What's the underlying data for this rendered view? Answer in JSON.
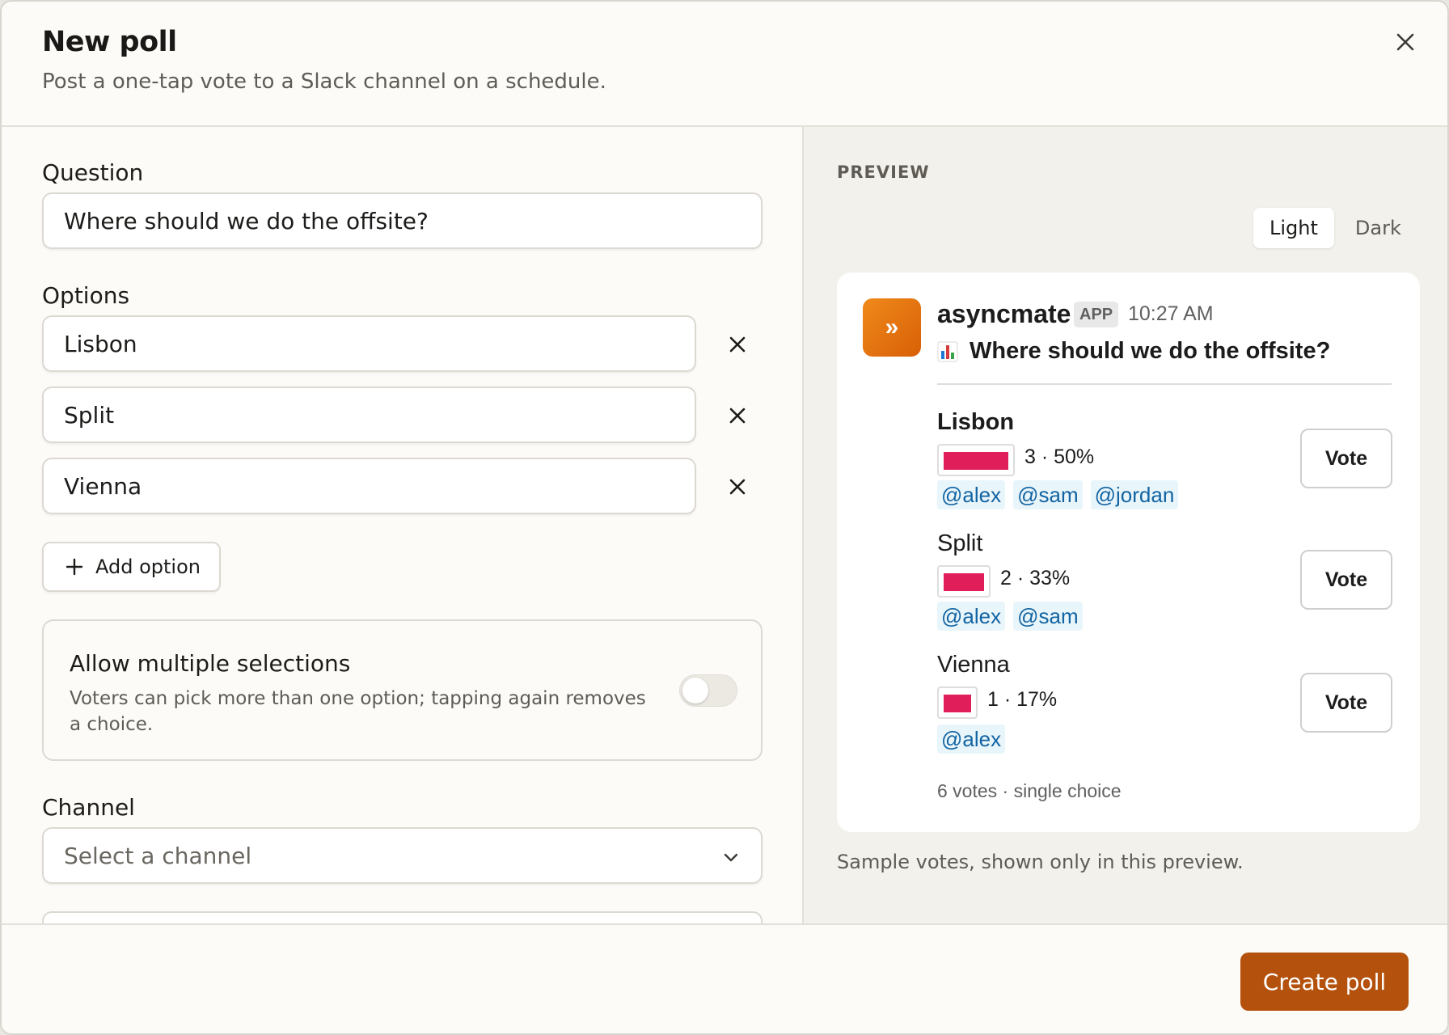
{
  "header": {
    "title": "New poll",
    "subtitle": "Post a one-tap vote to a Slack channel on a schedule."
  },
  "form": {
    "question_label": "Question",
    "question_value": "Where should we do the offsite?",
    "options_label": "Options",
    "options": [
      {
        "value": "Lisbon"
      },
      {
        "value": "Split"
      },
      {
        "value": "Vienna"
      }
    ],
    "add_option_label": "Add option",
    "multi_select": {
      "title": "Allow multiple selections",
      "description": "Voters can pick more than one option; tapping again removes a choice.",
      "enabled": false
    },
    "channel_label": "Channel",
    "channel_placeholder": "Select a channel"
  },
  "preview": {
    "label": "PREVIEW",
    "theme_options": [
      "Light",
      "Dark"
    ],
    "theme_selected": "Light",
    "message": {
      "sender": "asyncmate",
      "badge": "APP",
      "time": "10:27 AM",
      "icon_glyph": "»",
      "question_icon": "bar-chart-icon",
      "question": "Where should we do the offsite?",
      "vote_label": "Vote",
      "results": [
        {
          "name": "Lisbon",
          "stat": "3 · 50%",
          "fraction": 0.5,
          "leading": true,
          "voters": [
            "@alex",
            "@sam",
            "@jordan"
          ]
        },
        {
          "name": "Split",
          "stat": "2 · 33%",
          "fraction": 0.33,
          "leading": false,
          "voters": [
            "@alex",
            "@sam"
          ]
        },
        {
          "name": "Vienna",
          "stat": "1 · 17%",
          "fraction": 0.17,
          "leading": false,
          "voters": [
            "@alex"
          ]
        }
      ],
      "summary": "6 votes · single choice"
    },
    "note": "Sample votes, shown only in this preview."
  },
  "footer": {
    "create_label": "Create poll"
  },
  "colors": {
    "accent": "#b4520d",
    "bar": "#e01e5a",
    "mention_text": "#1264a3",
    "mention_bg": "#e8f5fa"
  }
}
